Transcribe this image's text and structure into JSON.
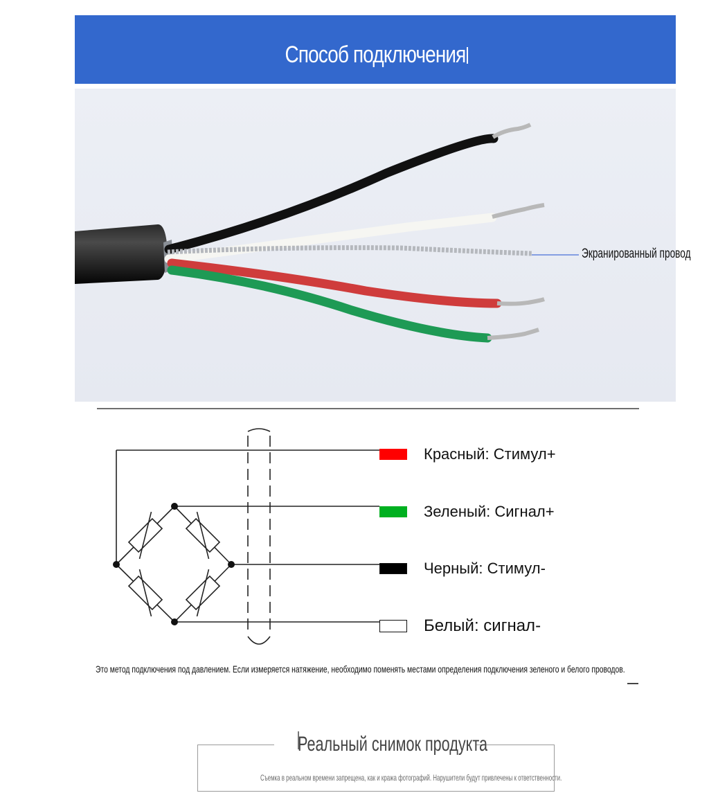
{
  "header": {
    "title": "Способ подключения"
  },
  "photo": {
    "shield_label": "Экранированный провод"
  },
  "legend": [
    {
      "label": "Красный: Стимул+",
      "color": "#ff0000"
    },
    {
      "label": "Зеленый: Сигнал+",
      "color": "#00b020"
    },
    {
      "label": "Черный: Стимул-",
      "color": "#000000"
    },
    {
      "label": "Белый: сигнал-",
      "color": "#ffffff"
    }
  ],
  "note": "Это метод подключения под давлением. Если измеряется натяжение, необходимо поменять местами определения подключения зеленого и белого проводов.",
  "real_photo": {
    "title": "Реальный снимок продукта",
    "subtitle": "Съемка в реальном времени запрещена, как и кража фотографий. Нарушители будут привлечены к ответственности."
  },
  "colors": {
    "banner": "#3368cd"
  }
}
